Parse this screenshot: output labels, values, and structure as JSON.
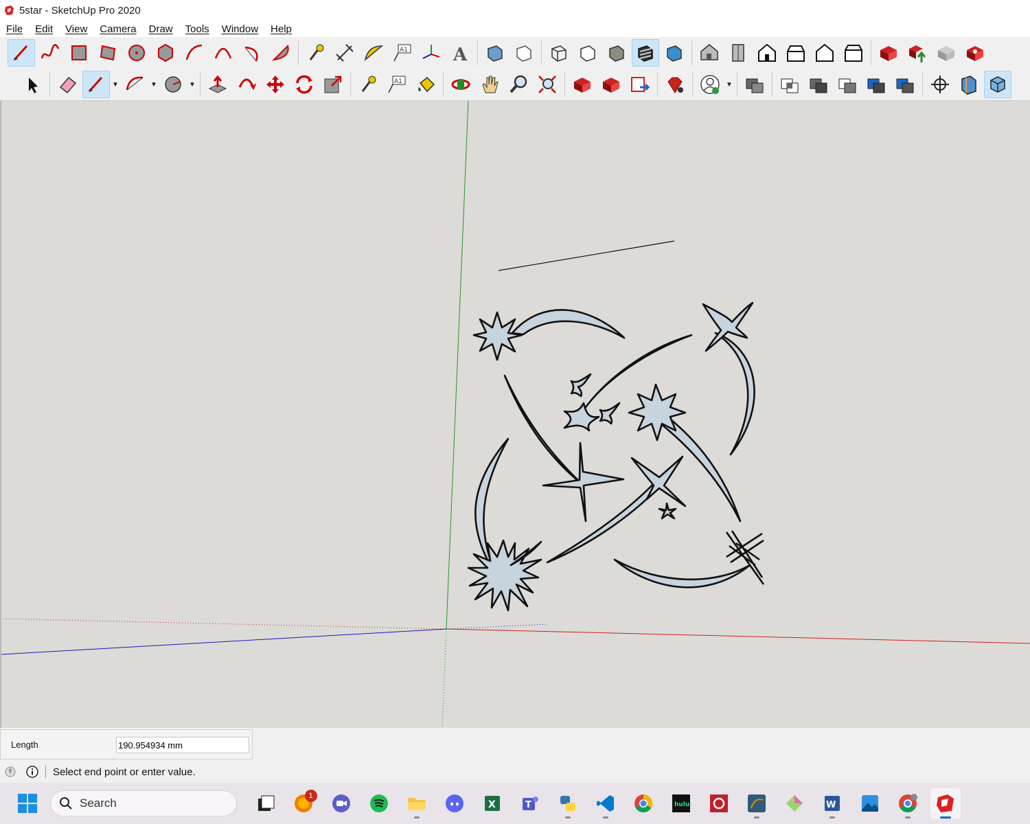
{
  "window": {
    "title": "5star - SketchUp Pro 2020"
  },
  "menu": [
    "File",
    "Edit",
    "View",
    "Camera",
    "Draw",
    "Tools",
    "Window",
    "Help"
  ],
  "toolbar1": {
    "icons": [
      "line-tool-icon",
      "freehand-tool-icon",
      "rectangle-tool-icon",
      "rotated-rectangle-icon",
      "circle-tool-icon",
      "polygon-tool-icon",
      "arc-tool-icon",
      "two-point-arc-icon",
      "three-point-arc-icon",
      "pie-tool-icon",
      "tape-measure-icon",
      "dimension-tool-icon",
      "protractor-icon",
      "text-tool-icon",
      "axes-tool-icon",
      "3d-text-icon",
      "xray-icon",
      "back-edges-icon",
      "wireframe-icon",
      "hidden-line-icon",
      "shaded-icon",
      "shaded-textures-icon",
      "monochrome-icon",
      "iso-view-icon",
      "top-view-icon",
      "front-view-icon",
      "right-view-icon",
      "back-view-icon",
      "left-view-icon",
      "warehouse-icon",
      "share-model-icon",
      "share-component-icon",
      "extension-warehouse-icon"
    ]
  },
  "toolbar2": {
    "icons": [
      "select-tool-icon",
      "eraser-tool-icon",
      "line-tool-icon",
      "arc-tool-icon",
      "circle-tool-icon",
      "push-pull-icon",
      "follow-me-icon",
      "move-tool-icon",
      "rotate-tool-icon",
      "scale-tool-icon",
      "tape-measure-icon",
      "text-tool-icon",
      "paint-bucket-icon",
      "orbit-tool-icon",
      "pan-tool-icon",
      "zoom-tool-icon",
      "zoom-extents-icon",
      "warehouse-icon",
      "share-model-icon",
      "layout-send-icon",
      "extension-manager-icon",
      "account-icon",
      "union-icon",
      "intersect-icon",
      "subtract-icon",
      "trim-icon",
      "split-icon",
      "outer-shell-icon",
      "position-camera-icon",
      "section-plane-icon",
      "view-cube-icon"
    ]
  },
  "vcb": {
    "label": "Length",
    "value": "190.954934 mm"
  },
  "status": {
    "text": "Select end point or enter value."
  },
  "taskbar": {
    "search_placeholder": "Search",
    "apps": [
      "task-view-icon",
      "firefox-icon",
      "zoom-icon",
      "spotify-icon",
      "file-explorer-icon",
      "discord-icon",
      "excel-icon",
      "teams-icon",
      "python-icon",
      "vscode-icon",
      "chrome-icon",
      "hulu-icon",
      "settings-app-icon",
      "mysql-icon",
      "gitkraken-icon",
      "word-icon",
      "photos-icon",
      "chrome-canary-icon",
      "sketchup-icon"
    ],
    "notification_badge": "1"
  },
  "colors": {
    "axis_red": "#cc2020",
    "axis_green": "#1e9a1e",
    "axis_blue": "#1a1ab8",
    "shape_fill": "#c7d3dd",
    "viewport_bg": "#dcdbd7"
  }
}
